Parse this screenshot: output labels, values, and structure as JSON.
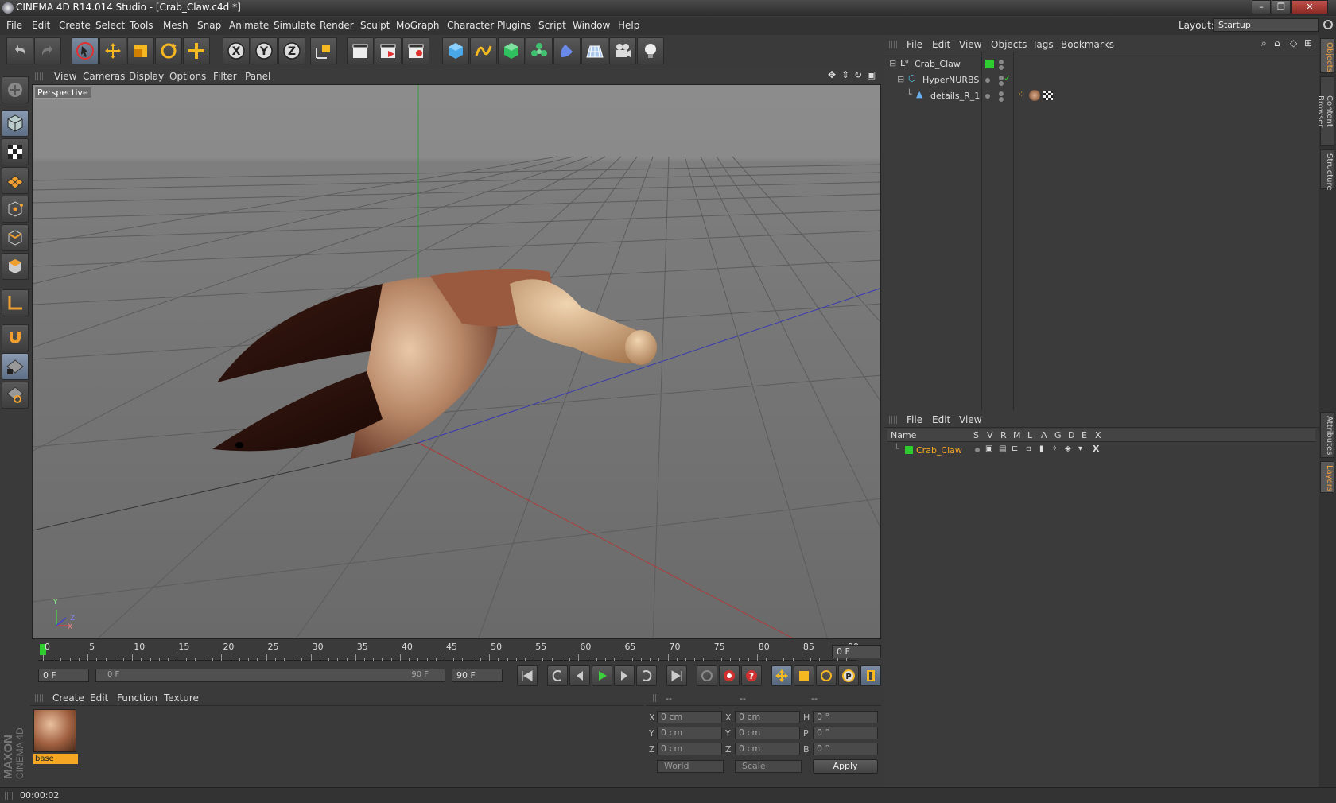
{
  "app": {
    "title": "CINEMA 4D R14.014 Studio - [Crab_Claw.c4d *]",
    "window_buttons": [
      "–",
      "❐",
      "✕"
    ]
  },
  "menu": [
    "File",
    "Edit",
    "Create",
    "Select",
    "Tools",
    "Mesh",
    "Snap",
    "Animate",
    "Simulate",
    "Render",
    "Sculpt",
    "MoGraph",
    "Character",
    "Plugins",
    "Script",
    "Window",
    "Help"
  ],
  "layout": {
    "label": "Layout:",
    "value": "Startup"
  },
  "viewport": {
    "menu": [
      "View",
      "Cameras",
      "Display",
      "Options",
      "Filter",
      "Panel"
    ],
    "label": "Perspective",
    "axis_labels": {
      "y": "Y",
      "z": "Z",
      "x": "X"
    }
  },
  "timeline": {
    "ticks": [
      "0",
      "5",
      "10",
      "15",
      "20",
      "25",
      "30",
      "35",
      "40",
      "45",
      "50",
      "55",
      "60",
      "65",
      "70",
      "75",
      "80",
      "85",
      "90"
    ],
    "current_frame": "0 F",
    "start_field": "0 F",
    "range_start": "0 F",
    "range_end": "90 F",
    "end_field": "90 F"
  },
  "material_panel": {
    "menu": [
      "Create",
      "Edit",
      "Function",
      "Texture"
    ],
    "materials": [
      {
        "name": "base"
      }
    ]
  },
  "coordinates": {
    "headers": [
      "--",
      "--",
      "--"
    ],
    "rows": [
      {
        "axis": "X",
        "pos": "0 cm",
        "size_axis": "X",
        "size": "0 cm",
        "rot_axis": "H",
        "rot": "0 °"
      },
      {
        "axis": "Y",
        "pos": "0 cm",
        "size_axis": "Y",
        "size": "0 cm",
        "rot_axis": "P",
        "rot": "0 °"
      },
      {
        "axis": "Z",
        "pos": "0 cm",
        "size_axis": "Z",
        "size": "0 cm",
        "rot_axis": "B",
        "rot": "0 °"
      }
    ],
    "mode": "World",
    "size_mode": "Scale",
    "apply": "Apply"
  },
  "objects_panel": {
    "menu": [
      "File",
      "Edit",
      "View",
      "Objects",
      "Tags",
      "Bookmarks"
    ],
    "items": [
      {
        "name": "Crab_Claw",
        "level": 0
      },
      {
        "name": "HyperNURBS",
        "level": 1
      },
      {
        "name": "details_R_1",
        "level": 2
      }
    ]
  },
  "layers_panel": {
    "menu": [
      "File",
      "Edit",
      "View"
    ],
    "columns": [
      "Name",
      "S",
      "V",
      "R",
      "M",
      "L",
      "A",
      "G",
      "D",
      "E",
      "X"
    ],
    "layers": [
      {
        "name": "Crab_Claw",
        "color": "#2ecc2e"
      }
    ]
  },
  "side_tabs": [
    "Objects",
    "Content Browser",
    "Structure",
    "Attributes",
    "Layers"
  ],
  "brand": {
    "line1": "MAXON",
    "line2": "CINEMA 4D"
  },
  "status": "00:00:02",
  "colors": {
    "accent": "#f0a030",
    "selection": "#f5a623",
    "green_layer": "#2ecc2e"
  }
}
